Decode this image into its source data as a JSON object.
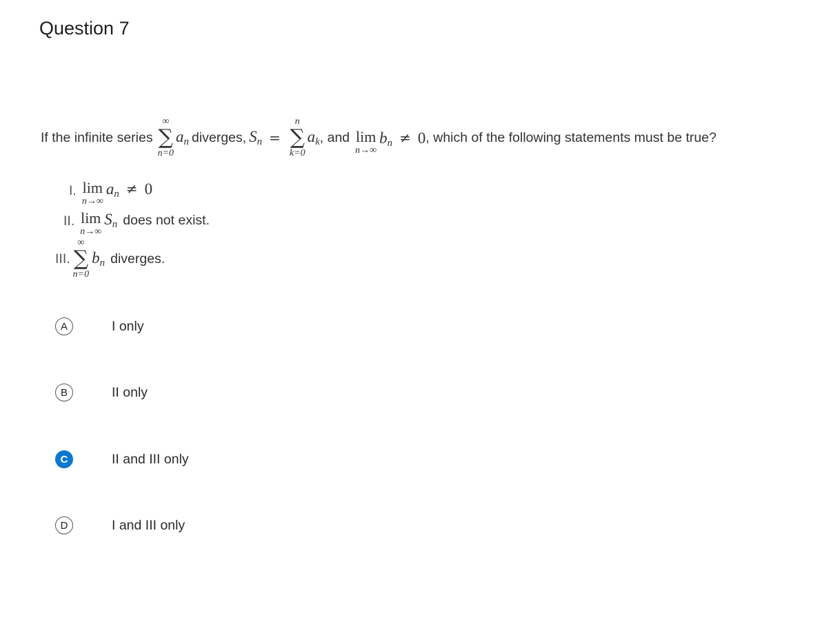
{
  "question": {
    "title": "Question 7",
    "stem": {
      "prefix": "If the infinite series",
      "sum1": {
        "upper": "∞",
        "lower": "n=0",
        "term_var": "a",
        "term_sub": "n"
      },
      "mid1": "diverges,",
      "sn_var": "S",
      "sn_sub": "n",
      "equals": "=",
      "sum2": {
        "upper": "n",
        "lower": "k=0",
        "term_var": "a",
        "term_sub": "k"
      },
      "mid2": ", and",
      "lim": {
        "op": "lim",
        "sub": "n→∞",
        "var": "b",
        "var_sub": "n"
      },
      "neq": "≠",
      "zero": "0",
      "suffix": ", which of the following statements must be true?"
    },
    "statements": [
      {
        "label": "I.",
        "lim_op": "lim",
        "lim_sub": "n→∞",
        "var": "a",
        "var_sub": "n",
        "rel": "≠",
        "rhs": "0",
        "text": ""
      },
      {
        "label": "II.",
        "lim_op": "lim",
        "lim_sub": "n→∞",
        "var": "S",
        "var_sub": "n",
        "text": "does not exist."
      },
      {
        "label": "III.",
        "sum_upper": "∞",
        "sum_lower": "n=0",
        "var": "b",
        "var_sub": "n",
        "text": "diverges."
      }
    ],
    "options": [
      {
        "letter": "A",
        "text": "I only",
        "selected": false
      },
      {
        "letter": "B",
        "text": "II only",
        "selected": false
      },
      {
        "letter": "C",
        "text": "II and III only",
        "selected": true
      },
      {
        "letter": "D",
        "text": "I and III only",
        "selected": false
      }
    ],
    "selected_option": "C",
    "colors": {
      "selected": "#0b78d0",
      "text": "#2b2b2b"
    }
  }
}
